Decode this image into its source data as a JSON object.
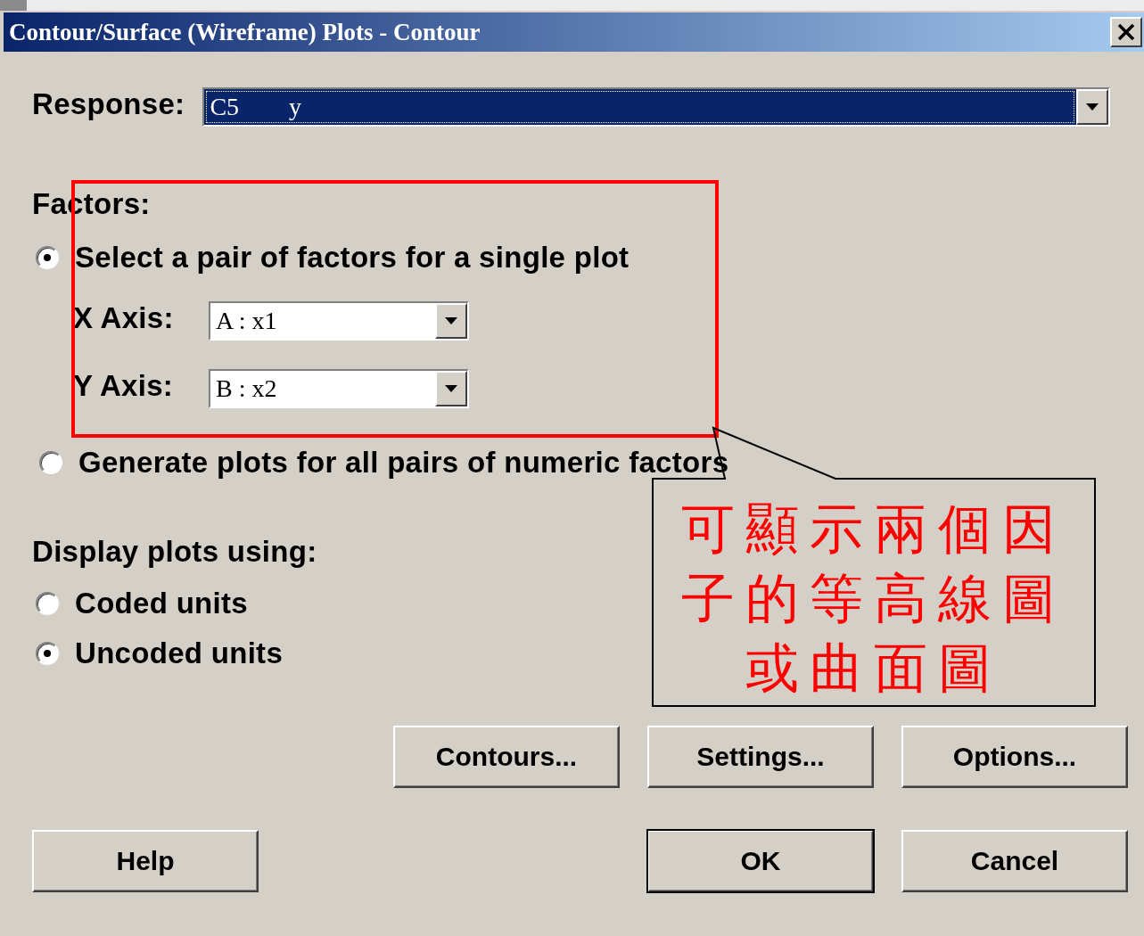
{
  "window": {
    "title": "Contour/Surface (Wireframe) Plots - Contour"
  },
  "response": {
    "label": "Response:",
    "value": "C5        y"
  },
  "factors": {
    "label": "Factors:",
    "options": [
      {
        "kind": "pair",
        "label": "Select a pair of factors for a single plot",
        "selected": true
      },
      {
        "kind": "all",
        "label": "Generate plots for all pairs of numeric factors",
        "selected": false
      }
    ],
    "axes": [
      {
        "label": "X Axis:",
        "value": "A : x1"
      },
      {
        "label": "Y Axis:",
        "value": "B : x2"
      }
    ]
  },
  "units": {
    "label": "Display plots using:",
    "options": [
      {
        "label": "Coded units",
        "selected": false
      },
      {
        "label": "Uncoded units",
        "selected": true
      }
    ]
  },
  "button_rows": [
    [
      {
        "label": "Contours...",
        "default": false
      },
      {
        "label": "Settings...",
        "default": false
      },
      {
        "label": "Options...",
        "default": false
      }
    ],
    [
      {
        "label": "Help",
        "default": false
      },
      {
        "label": "OK",
        "default": true
      },
      {
        "label": "Cancel",
        "default": false
      }
    ]
  ],
  "annotation": {
    "text": "可顯示兩個因子的等高線圖或曲面圖"
  }
}
